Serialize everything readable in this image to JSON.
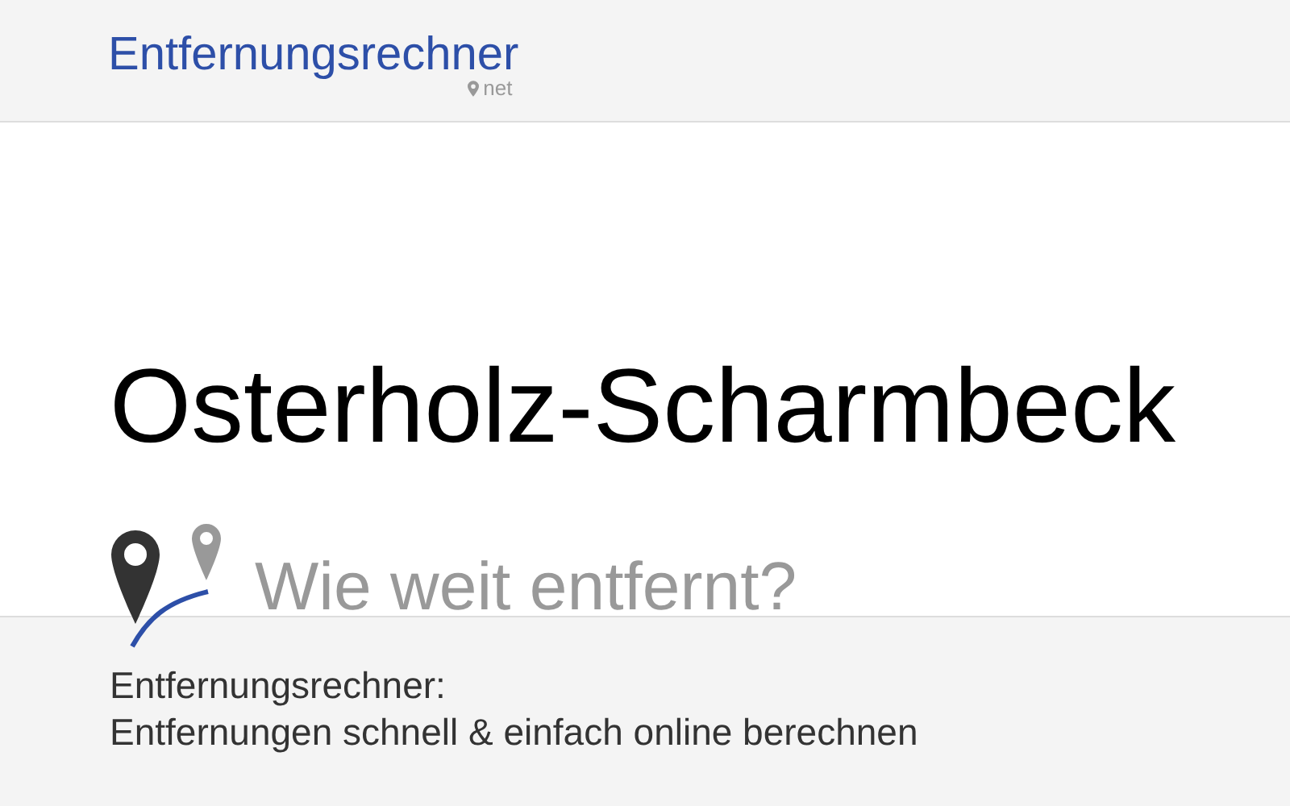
{
  "header": {
    "logo": "Entfernungsrechner",
    "logo_suffix": "net"
  },
  "hero": {
    "title": "Osterholz-Scharmbeck",
    "subtitle": "Wie weit entfernt?"
  },
  "footer": {
    "lines": [
      "Entfernungsrechner:",
      "Entfernungen schnell & einfach online berechnen"
    ]
  }
}
